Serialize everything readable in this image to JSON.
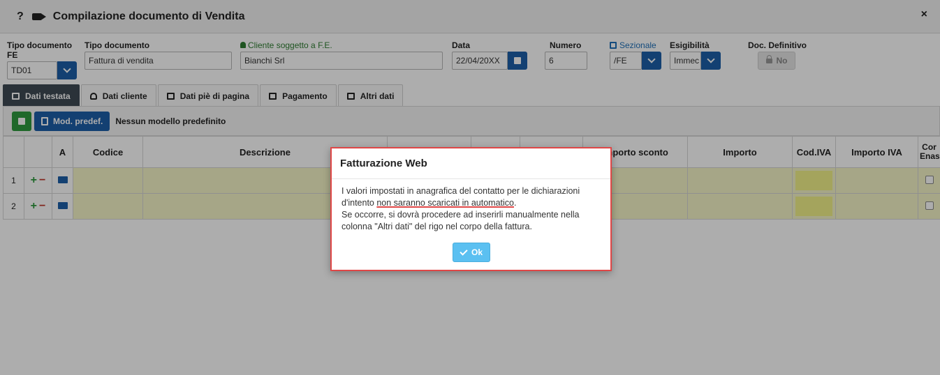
{
  "window": {
    "title": "Compilazione documento di Vendita",
    "help_glyph": "?",
    "close_glyph": "×"
  },
  "fields": {
    "tipo_fe_label": "Tipo documento FE",
    "tipo_fe_value": "TD01",
    "tipo_doc_label": "Tipo documento",
    "tipo_doc_value": "Fattura di vendita",
    "cliente_label": "Cliente soggetto a F.E.",
    "cliente_value": "Bianchi Srl",
    "data_label": "Data",
    "data_value": "22/04/20XX",
    "numero_label": "Numero",
    "numero_value": "6",
    "sezionale_label": "Sezionale",
    "sezionale_value": "/FE",
    "esigibilita_label": "Esigibilità",
    "esigibilita_value": "Immec",
    "definitivo_label": "Doc. Definitivo",
    "definitivo_value": "No"
  },
  "tabs": [
    {
      "label": "Dati testata",
      "active": true
    },
    {
      "label": "Dati cliente",
      "active": false
    },
    {
      "label": "Dati piè di pagina",
      "active": false
    },
    {
      "label": "Pagamento",
      "active": false
    },
    {
      "label": "Altri dati",
      "active": false
    }
  ],
  "toolbar": {
    "mod_label": "Mod. predef.",
    "note": "Nessun modello predefinito"
  },
  "grid": {
    "headers": [
      "",
      "",
      "A",
      "Codice",
      "Descrizione",
      "",
      "",
      "",
      "Importo sconto",
      "Importo",
      "Cod.IVA",
      "Importo IVA",
      "Cor Enas"
    ],
    "rows": [
      {
        "num": "1",
        "plus": "+",
        "minus": "−"
      },
      {
        "num": "2",
        "plus": "+",
        "minus": "−"
      }
    ]
  },
  "dialog": {
    "title": "Fatturazione Web",
    "line1": "I valori impostati in anagrafica del contatto per le dichiarazioni d'intento ",
    "underlined": "non saranno scaricati in automatico",
    "line1_end": ".",
    "line2": "Se occorre, si dovrà procedere ad inserirli manualmente nella colonna \"Altri dati\" del rigo nel corpo della fattura.",
    "ok_label": "Ok"
  },
  "colors": {
    "accent": "#1d5fa8",
    "save": "#2e9a3e",
    "dialog_border": "#e04747",
    "ok_button": "#5bc0f1",
    "row_highlight": "#f5f5c8"
  }
}
